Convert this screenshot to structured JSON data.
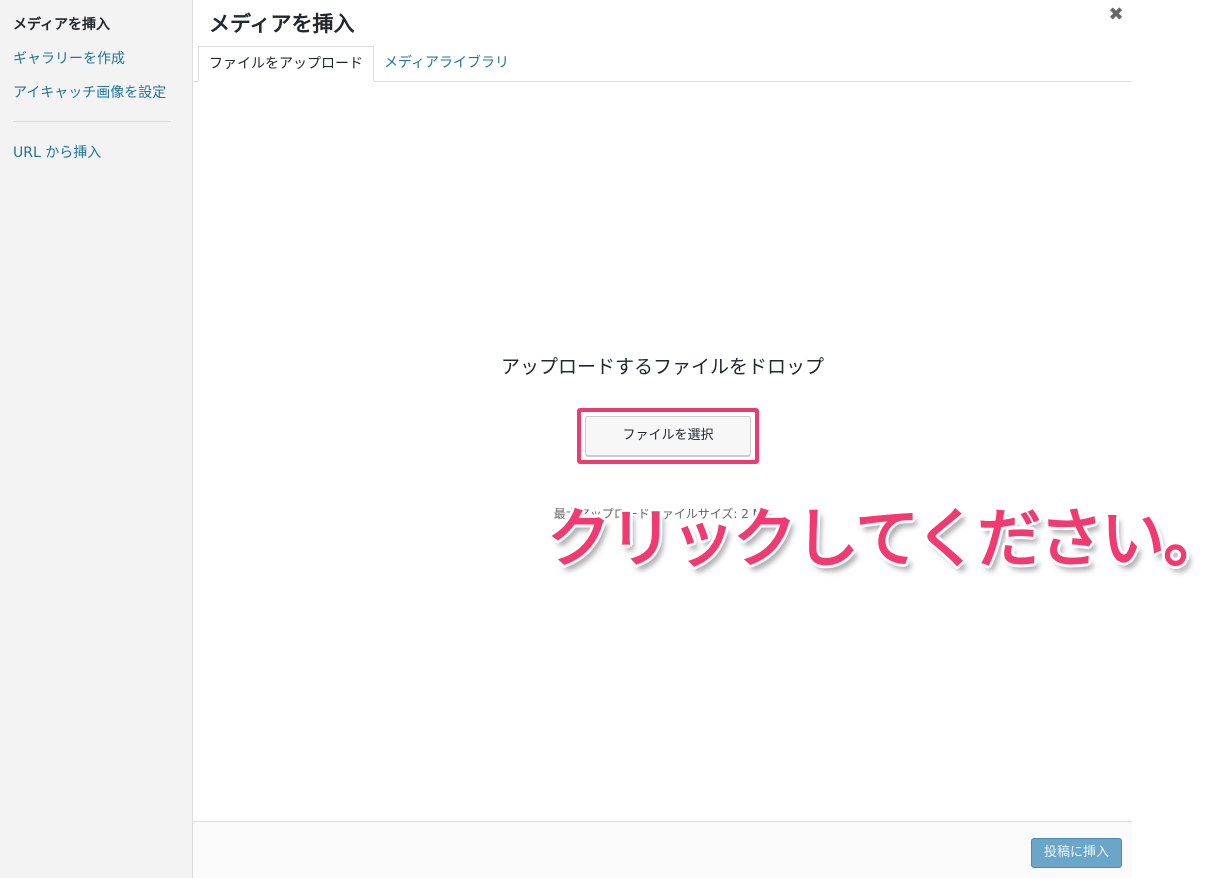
{
  "sidebar": {
    "items": [
      {
        "label": "メディアを挿入",
        "active": true
      },
      {
        "label": "ギャラリーを作成",
        "active": false
      },
      {
        "label": "アイキャッチ画像を設定",
        "active": false
      },
      {
        "label": "URL から挿入",
        "active": false
      }
    ]
  },
  "frame": {
    "title": "メディアを挿入",
    "close_glyph": "✖"
  },
  "tabs": [
    {
      "label": "ファイルをアップロード",
      "active": true
    },
    {
      "label": "メディアライブラリ",
      "active": false
    }
  ],
  "uploader": {
    "instructions": "アップロードするファイルをドロップ",
    "select_button": "ファイルを選択",
    "max_size_text": "最大アップロードファイルサイズ: 2 MB"
  },
  "annotation": {
    "text": "クリックしてください。",
    "color": "#f23a72"
  },
  "toolbar": {
    "insert_button": "投稿に挿入"
  },
  "colors": {
    "link": "#21759b",
    "highlight": "#ee3a72",
    "primary_disabled": "#6ba5c8"
  }
}
